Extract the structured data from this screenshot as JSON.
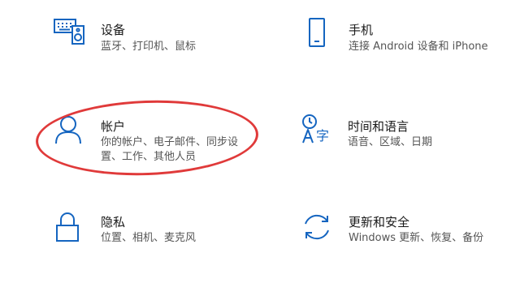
{
  "accent_color": "#1565c0",
  "annotation_color": "#e03a3a",
  "tiles": [
    {
      "key": "devices",
      "icon": "keyboard-speaker-icon",
      "title": "设备",
      "desc": [
        "蓝牙、打印机、鼠标"
      ]
    },
    {
      "key": "phone",
      "icon": "phone-icon",
      "title": "手机",
      "desc": [
        "连接 Android 设备和 iPhone"
      ]
    },
    {
      "key": "accounts",
      "icon": "person-icon",
      "title": "帐户",
      "desc": [
        "你的帐户、电子邮件、同步设",
        "置、工作、其他人员"
      ]
    },
    {
      "key": "time-language",
      "icon": "language-icon",
      "title": "时间和语言",
      "desc": [
        "语音、区域、日期"
      ]
    },
    {
      "key": "privacy",
      "icon": "lock-icon",
      "title": "隐私",
      "desc": [
        "位置、相机、麦克风"
      ]
    },
    {
      "key": "update-security",
      "icon": "sync-icon",
      "title": "更新和安全",
      "desc": [
        "Windows 更新、恢复、备份"
      ]
    }
  ]
}
